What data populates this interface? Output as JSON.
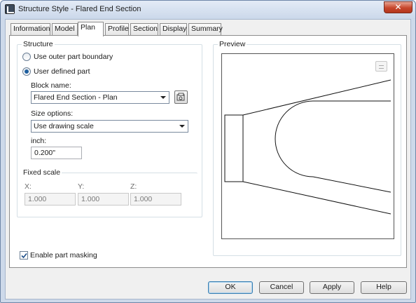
{
  "window": {
    "title": "Structure Style - Flared End Section",
    "close_glyph": "✕"
  },
  "tabs": [
    {
      "label": "Information",
      "active": false
    },
    {
      "label": "Model",
      "active": false
    },
    {
      "label": "Plan",
      "active": true
    },
    {
      "label": "Profile",
      "active": false
    },
    {
      "label": "Section",
      "active": false
    },
    {
      "label": "Display",
      "active": false
    },
    {
      "label": "Summary",
      "active": false
    }
  ],
  "structure": {
    "group_title": "Structure",
    "option_outer": "Use outer part boundary",
    "option_user": "User defined part",
    "selected_option": "User defined part",
    "block_name_label": "Block name:",
    "block_name_value": "Flared End Section - Plan",
    "block_tool_icon": "browse-block-icon",
    "size_options_label": "Size options:",
    "size_options_value": "Use drawing scale",
    "inch_label": "inch:",
    "inch_value": "0.200\"",
    "fixed_scale_title": "Fixed scale",
    "x_label": "X:",
    "x_value": "1.000",
    "y_label": "Y:",
    "y_value": "1.000",
    "z_label": "Z:",
    "z_value": "1.000"
  },
  "preview": {
    "group_title": "Preview",
    "mini_icon": "preview-options-icon"
  },
  "masking": {
    "label": "Enable part masking",
    "checked": true
  },
  "buttons": {
    "ok": "OK",
    "cancel": "Cancel",
    "apply": "Apply",
    "help": "Help"
  },
  "colors": {
    "titlebar": "#cbd8ea",
    "close": "#c7462c",
    "radio_dot": "#1e5f9e"
  }
}
